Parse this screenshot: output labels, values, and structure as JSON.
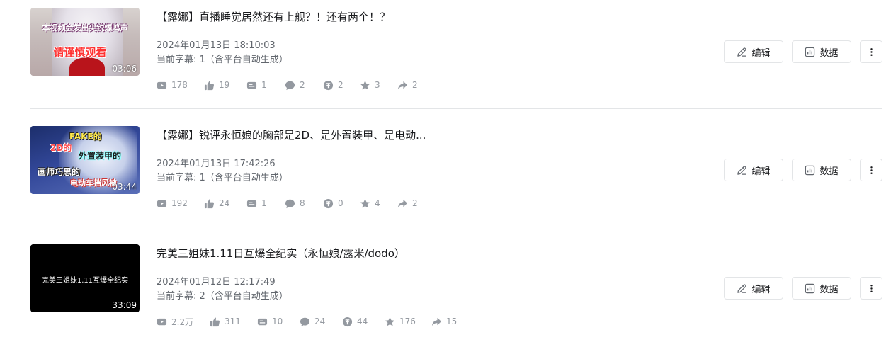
{
  "videos": [
    {
      "title": "【露娜】直播睡觉居然还有上舰？！还有两个！？",
      "date": "2024年01月13日 18:10:03",
      "subtitle": "当前字幕: 1（含平台自动生成）",
      "duration": "03:06",
      "thumb_text": [
        "本视频会发出尖锐爆鸣声",
        "请谨慎观看"
      ],
      "stats": {
        "plays": "178",
        "likes": "19",
        "danmaku": "1",
        "comments": "2",
        "coins": "2",
        "favorites": "3",
        "shares": "2"
      }
    },
    {
      "title": "【露娜】锐评永恒娘的胸部是2D、是外置装甲、是电动...",
      "date": "2024年01月13日 17:42:26",
      "subtitle": "当前字幕: 1（含平台自动生成）",
      "duration": "03:44",
      "thumb_text": [
        "FAKE的",
        "2D的",
        "外置装甲的",
        "画师巧思的",
        "电动车挡风被"
      ],
      "stats": {
        "plays": "192",
        "likes": "24",
        "danmaku": "1",
        "comments": "8",
        "coins": "0",
        "favorites": "4",
        "shares": "2"
      }
    },
    {
      "title": "完美三姐妹1.11日互爆全纪实（永恒娘/露米/dodo）",
      "date": "2024年01月12日 12:17:49",
      "subtitle": "当前字幕: 2（含平台自动生成）",
      "duration": "33:09",
      "thumb_text": [
        "完美三姐妹1.11互爆全纪实"
      ],
      "stats": {
        "plays": "2.2万",
        "likes": "311",
        "danmaku": "10",
        "comments": "24",
        "coins": "44",
        "favorites": "176",
        "shares": "15"
      }
    }
  ],
  "actions": {
    "edit_label": "编辑",
    "data_label": "数据"
  },
  "icons": {
    "plays": "play-count-icon",
    "likes": "thumb-up-icon",
    "danmaku": "danmaku-icon",
    "comments": "comment-icon",
    "coins": "coin-icon",
    "favorites": "star-icon",
    "shares": "share-icon",
    "edit": "pencil-icon",
    "data": "bar-chart-icon",
    "more": "more-vertical-icon"
  },
  "colors": {
    "text": "#18191c",
    "meta": "#61666d",
    "stat": "#9499a0",
    "border": "#e3e5e7"
  }
}
